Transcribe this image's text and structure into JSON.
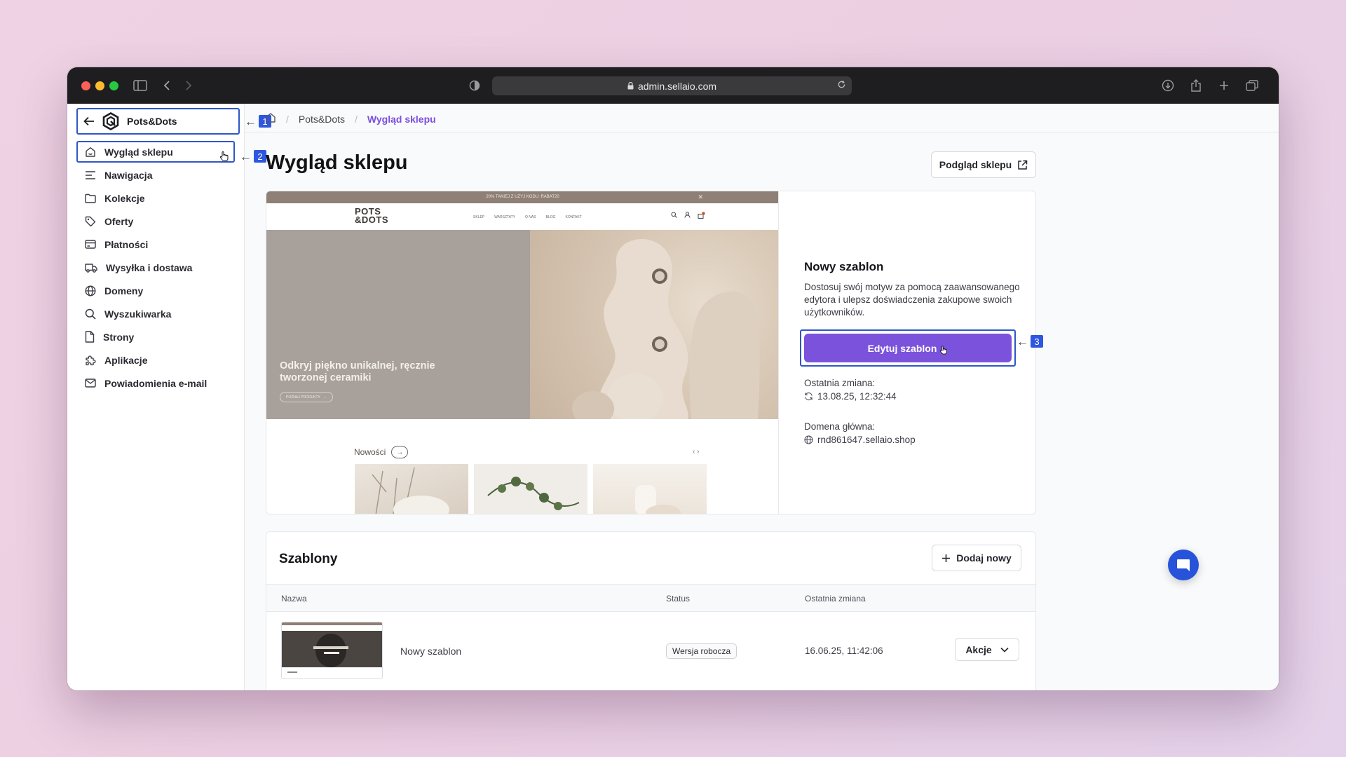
{
  "browser": {
    "url": "admin.sellaio.com"
  },
  "sidebar": {
    "store_name": "Pots&Dots",
    "items": [
      {
        "label": "Wygląd sklepu",
        "icon": "storefront-icon"
      },
      {
        "label": "Nawigacja",
        "icon": "menu-lines-icon"
      },
      {
        "label": "Kolekcje",
        "icon": "folder-icon"
      },
      {
        "label": "Oferty",
        "icon": "tag-icon"
      },
      {
        "label": "Płatności",
        "icon": "credit-card-icon"
      },
      {
        "label": "Wysyłka i dostawa",
        "icon": "truck-icon"
      },
      {
        "label": "Domeny",
        "icon": "globe-icon"
      },
      {
        "label": "Wyszukiwarka",
        "icon": "search-icon"
      },
      {
        "label": "Strony",
        "icon": "page-icon"
      },
      {
        "label": "Aplikacje",
        "icon": "puzzle-icon"
      },
      {
        "label": "Powiadomienia e-mail",
        "icon": "mail-icon"
      }
    ]
  },
  "annotations": {
    "one": "1",
    "two": "2",
    "three": "3"
  },
  "breadcrumb": {
    "store": "Pots&Dots",
    "current": "Wygląd sklepu"
  },
  "page": {
    "title": "Wygląd sklepu",
    "preview_button": "Podgląd sklepu"
  },
  "store_preview": {
    "promo_bar": "20% TANIEJ Z UŻYJ KODU: RABAT20",
    "logo_line1": "POTS",
    "logo_line2": "&DOTS",
    "menu": [
      "SKLEP",
      "WARSZTATY",
      "O NAS",
      "BLOG",
      "KONTAKT"
    ],
    "hero_text": "Odkryj piękno unikalnej, ręcznie tworzonej ceramiki",
    "hero_button": "POZNAJ PRODUKTY",
    "new_section": "Nowości"
  },
  "theme_panel": {
    "title": "Nowy szablon",
    "description": "Dostosuj swój motyw za pomocą zaawansowanego edytora i ulepsz doświadczenia zakupowe swoich użytkowników.",
    "edit_button": "Edytuj szablon",
    "last_change_label": "Ostatnia zmiana:",
    "last_change_value": "13.08.25, 12:32:44",
    "domain_label": "Domena główna:",
    "domain_value": "rnd861647.sellaio.shop"
  },
  "templates": {
    "title": "Szablony",
    "add_button": "Dodaj nowy",
    "columns": {
      "name": "Nazwa",
      "status": "Status",
      "last_change": "Ostatnia zmiana"
    },
    "rows": [
      {
        "name": "Nowy szablon",
        "status": "Wersja robocza",
        "last_change": "16.06.25, 11:42:06",
        "action": "Akcje"
      }
    ]
  },
  "colors": {
    "accent": "#7b52dc",
    "highlight_border": "#2e56c8",
    "chat": "#2653d9"
  }
}
